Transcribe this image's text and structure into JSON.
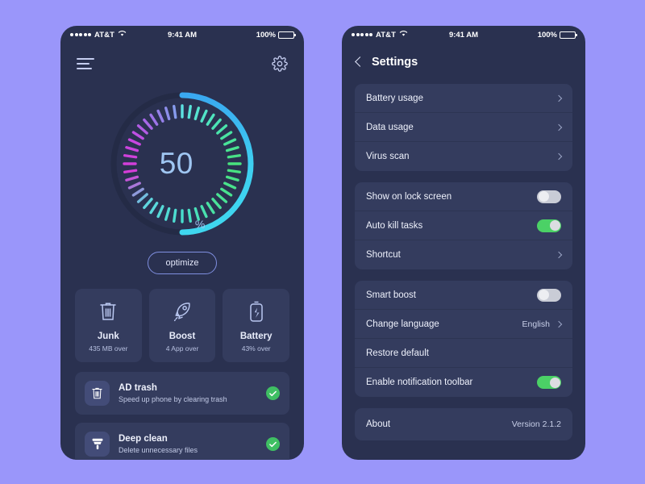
{
  "colors": {
    "page_background": "#9a96fa",
    "phone_background": "#2a3150",
    "card_background": "#343c5e",
    "accent_cyan": "#3cc9ef",
    "toggle_on_green": "#4bd166",
    "check_green": "#3fbf63",
    "gauge_text": "#9fc6f2"
  },
  "status_bar": {
    "carrier": "AT&T",
    "time": "9:41 AM",
    "battery": "100%",
    "signal_dots": 5,
    "wifi_icon": "wifi-icon",
    "battery_icon": "battery-icon"
  },
  "home": {
    "menu_icon": "hamburger-menu-icon",
    "settings_icon": "gear-icon",
    "gauge": {
      "value": "50",
      "unit": "%",
      "percent": 50,
      "arc_color": "#3cc9ef",
      "track_color": "#242b46"
    },
    "optimize_label": "optimize",
    "stat_cards": [
      {
        "icon": "trash-icon",
        "title": "Junk",
        "subtitle": "435 MB over"
      },
      {
        "icon": "rocket-icon",
        "title": "Boost",
        "subtitle": "4 App over"
      },
      {
        "icon": "battery-bolt-icon",
        "title": "Battery",
        "subtitle": "43% over"
      }
    ],
    "actions": [
      {
        "icon": "trash-icon",
        "title": "AD trash",
        "subtitle": "Speed up phone by clearing trash",
        "status_icon": "check-circle-icon"
      },
      {
        "icon": "brush-icon",
        "title": "Deep clean",
        "subtitle": "Delete unnecessary files",
        "status_icon": "check-circle-icon"
      }
    ]
  },
  "settings": {
    "back_icon": "chevron-left-icon",
    "title": "Settings",
    "groups": [
      {
        "rows": [
          {
            "label": "Battery usage",
            "type": "link",
            "icon": "chevron-right-icon"
          },
          {
            "label": "Data usage",
            "type": "link",
            "icon": "chevron-right-icon"
          },
          {
            "label": "Virus scan",
            "type": "link",
            "icon": "chevron-right-icon"
          }
        ]
      },
      {
        "rows": [
          {
            "label": "Show on lock screen",
            "type": "toggle",
            "on": false
          },
          {
            "label": "Auto kill tasks",
            "type": "toggle",
            "on": true
          },
          {
            "label": "Shortcut",
            "type": "link",
            "icon": "chevron-right-icon"
          }
        ]
      },
      {
        "rows": [
          {
            "label": "Smart boost",
            "type": "toggle",
            "on": false
          },
          {
            "label": "Change language",
            "type": "link",
            "value": "English",
            "icon": "chevron-right-icon"
          },
          {
            "label": "Restore default",
            "type": "plain"
          },
          {
            "label": "Enable notification toolbar",
            "type": "toggle",
            "on": true
          }
        ]
      },
      {
        "rows": [
          {
            "label": "About",
            "type": "value",
            "value": "Version 2.1.2"
          }
        ]
      }
    ]
  }
}
